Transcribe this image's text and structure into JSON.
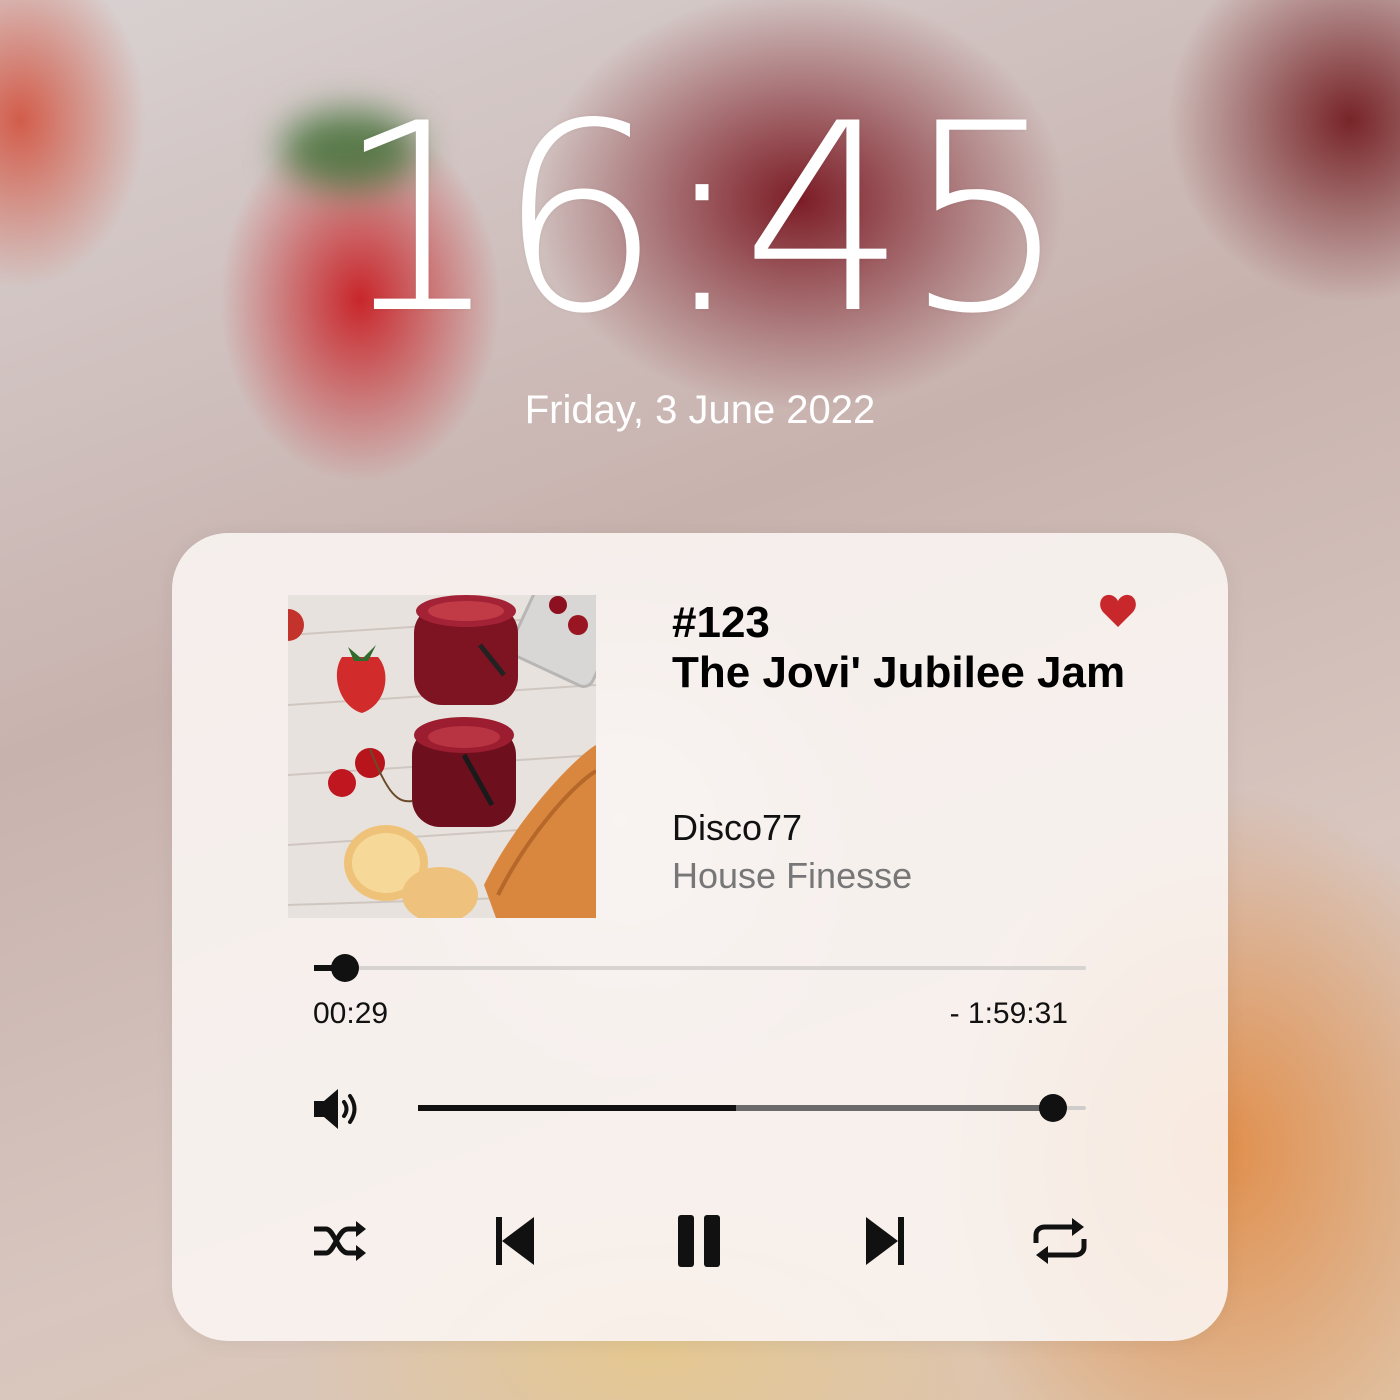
{
  "lockscreen": {
    "time": "16:45",
    "date": "Friday, 3 June 2022"
  },
  "player": {
    "episode_number": "#123",
    "title": "The Jovi' Jubilee Jam",
    "artist": "Disco77",
    "album": "House Finesse",
    "favorited": true,
    "elapsed": "00:29",
    "remaining": "- 1:59:31",
    "progress_fraction": 0.04,
    "volume_fraction": 0.95,
    "playing": true,
    "colors": {
      "heart": "#c8272b",
      "accent": "#111111"
    },
    "icons": {
      "favorite": "heart-icon",
      "volume": "speaker-icon",
      "shuffle": "shuffle-icon",
      "previous": "skip-previous-icon",
      "pause": "pause-icon",
      "next": "skip-next-icon",
      "repeat": "repeat-icon"
    }
  }
}
